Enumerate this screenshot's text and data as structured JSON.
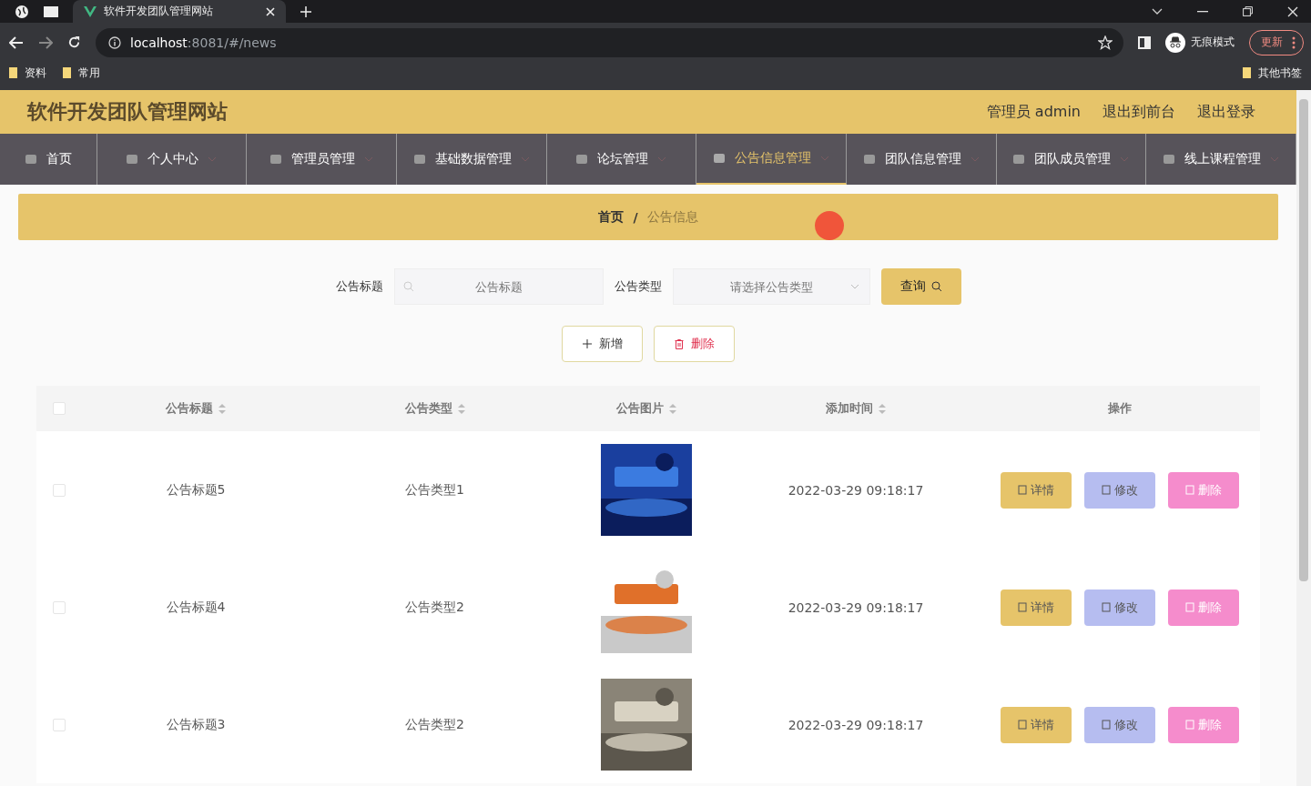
{
  "browser": {
    "tab_title": "软件开发团队管理网站",
    "url_host": "localhost",
    "url_rest": ":8081/#/news",
    "profile": "无痕模式",
    "update": "更新",
    "bookmarks": [
      "资料",
      "常用"
    ],
    "other_bookmarks": "其他书签"
  },
  "header": {
    "title": "软件开发团队管理网站",
    "user": "管理员 admin",
    "links": [
      "退出到前台",
      "退出登录"
    ]
  },
  "nav": [
    {
      "label": "首页",
      "selected": false,
      "dropdown": false
    },
    {
      "label": "个人中心",
      "selected": false,
      "dropdown": true
    },
    {
      "label": "管理员管理",
      "selected": false,
      "dropdown": true
    },
    {
      "label": "基础数据管理",
      "selected": false,
      "dropdown": true
    },
    {
      "label": "论坛管理",
      "selected": false,
      "dropdown": true
    },
    {
      "label": "公告信息管理",
      "selected": true,
      "dropdown": true
    },
    {
      "label": "团队信息管理",
      "selected": false,
      "dropdown": true
    },
    {
      "label": "团队成员管理",
      "selected": false,
      "dropdown": true
    },
    {
      "label": "线上课程管理",
      "selected": false,
      "dropdown": true
    }
  ],
  "breadcrumb": [
    "首页",
    "公告信息"
  ],
  "breadcrumb_separator": "/",
  "search": {
    "title_label": "公告标题",
    "title_placeholder": "公告标题",
    "type_label": "公告类型",
    "type_placeholder": "请选择公告类型",
    "query": "查询"
  },
  "actions": {
    "add": "新增",
    "delete": "删除"
  },
  "table": {
    "all_checked": false,
    "columns": [
      "公告标题",
      "公告类型",
      "公告图片",
      "添加时间",
      "操作"
    ],
    "rows": [
      {
        "title": "公告标题5",
        "type": "公告类型1",
        "time": "2022-03-29 09:18:17",
        "checked": false,
        "buttons": [
          "详情",
          "修改",
          "删除"
        ]
      },
      {
        "title": "公告标题4",
        "type": "公告类型2",
        "time": "2022-03-29 09:18:17",
        "checked": false,
        "buttons": [
          "详情",
          "修改",
          "删除"
        ]
      },
      {
        "title": "公告标题3",
        "type": "公告类型2",
        "time": "2022-03-29 09:18:17",
        "checked": false,
        "buttons": [
          "详情",
          "修改",
          "删除"
        ]
      }
    ]
  }
}
